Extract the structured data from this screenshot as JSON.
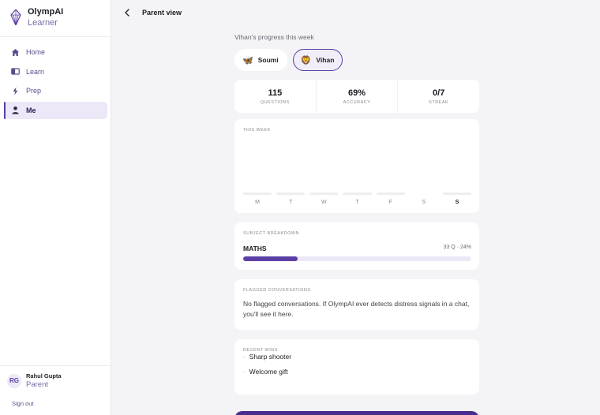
{
  "app": {
    "name": "OlympAI",
    "subtitle": "Learner",
    "accent": "#5b3fa6"
  },
  "sidebar": {
    "items": [
      {
        "label": "Home",
        "icon": "home-icon"
      },
      {
        "label": "Learn",
        "icon": "book-icon"
      },
      {
        "label": "Prep",
        "icon": "bolt-icon"
      },
      {
        "label": "Me",
        "icon": "person-icon",
        "active": true
      }
    ],
    "user": {
      "initials": "RG",
      "name": "Rahul Gupta",
      "role": "Parent"
    },
    "sign_out": "Sign out"
  },
  "header": {
    "back_icon": "chevron-left-icon",
    "title": "Parent view"
  },
  "main": {
    "progress_title": "Vihan's progress this week",
    "kids": [
      {
        "emoji": "🦋",
        "name": "Soumi",
        "active": false
      },
      {
        "emoji": "🦁",
        "name": "Vihan",
        "active": true
      }
    ],
    "stats": [
      {
        "value": "115",
        "label": "QUESTIONS"
      },
      {
        "value": "69%",
        "label": "ACCURACY"
      },
      {
        "value": "0/7",
        "label": "STREAK"
      }
    ],
    "week": {
      "label": "THIS WEEK",
      "days": [
        "M",
        "T",
        "W",
        "T",
        "F",
        "S",
        "S"
      ],
      "today_index": 6
    },
    "subject": {
      "label": "SUBJECT BREAKDOWN",
      "name": "MATHS",
      "meta": "33 Q · 24%",
      "progress": 0.24
    },
    "flagged": {
      "label": "FLAGGED CONVERSATIONS",
      "text": "No flagged conversations. If OlympAI ever detects distress signals in a chat, you'll see it here."
    },
    "wins": {
      "label": "RECENT WINS",
      "items": [
        "Sharp shooter",
        "Welcome gift"
      ]
    }
  }
}
